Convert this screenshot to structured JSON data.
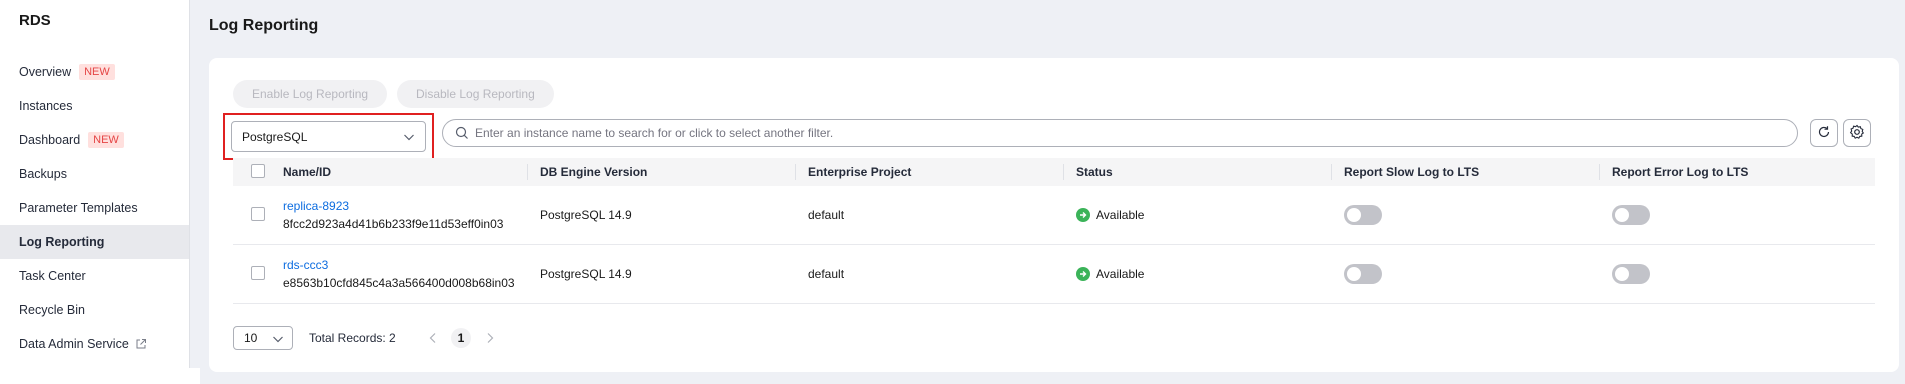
{
  "sidebar": {
    "brand": "RDS",
    "items": [
      {
        "label": "Overview",
        "badge": "NEW"
      },
      {
        "label": "Instances"
      },
      {
        "label": "Dashboard",
        "badge": "NEW"
      },
      {
        "label": "Backups"
      },
      {
        "label": "Parameter Templates"
      },
      {
        "label": "Log Reporting",
        "active": true
      },
      {
        "label": "Task Center"
      },
      {
        "label": "Recycle Bin"
      },
      {
        "label": "Data Admin Service",
        "icon": "external-link-icon"
      }
    ]
  },
  "page": {
    "title": "Log Reporting"
  },
  "toolbar": {
    "enable_label": "Enable Log Reporting",
    "disable_label": "Disable Log Reporting",
    "engine_value": "PostgreSQL",
    "search_placeholder": "Enter an instance name to search for or click to select another filter."
  },
  "table": {
    "headers": [
      "Name/ID",
      "DB Engine Version",
      "Enterprise Project",
      "Status",
      "Report Slow Log to LTS",
      "Report Error Log to LTS"
    ],
    "rows": [
      {
        "name": "replica-8923",
        "id": "8fcc2d923a4d41b6b233f9e11d53eff0in03",
        "version": "PostgreSQL 14.9",
        "project": "default",
        "status": "Available"
      },
      {
        "name": "rds-ccc3",
        "id": "e8563b10cfd845c4a3a566400d008b68in03",
        "version": "PostgreSQL 14.9",
        "project": "default",
        "status": "Available"
      }
    ]
  },
  "pagination": {
    "page_size": "10",
    "total": "Total Records: 2",
    "current_page": "1"
  },
  "colors": {
    "accent_link": "#0d6de0",
    "status_green": "#3bb359",
    "highlight_red": "#e02020",
    "badge_red": "#e54545"
  }
}
